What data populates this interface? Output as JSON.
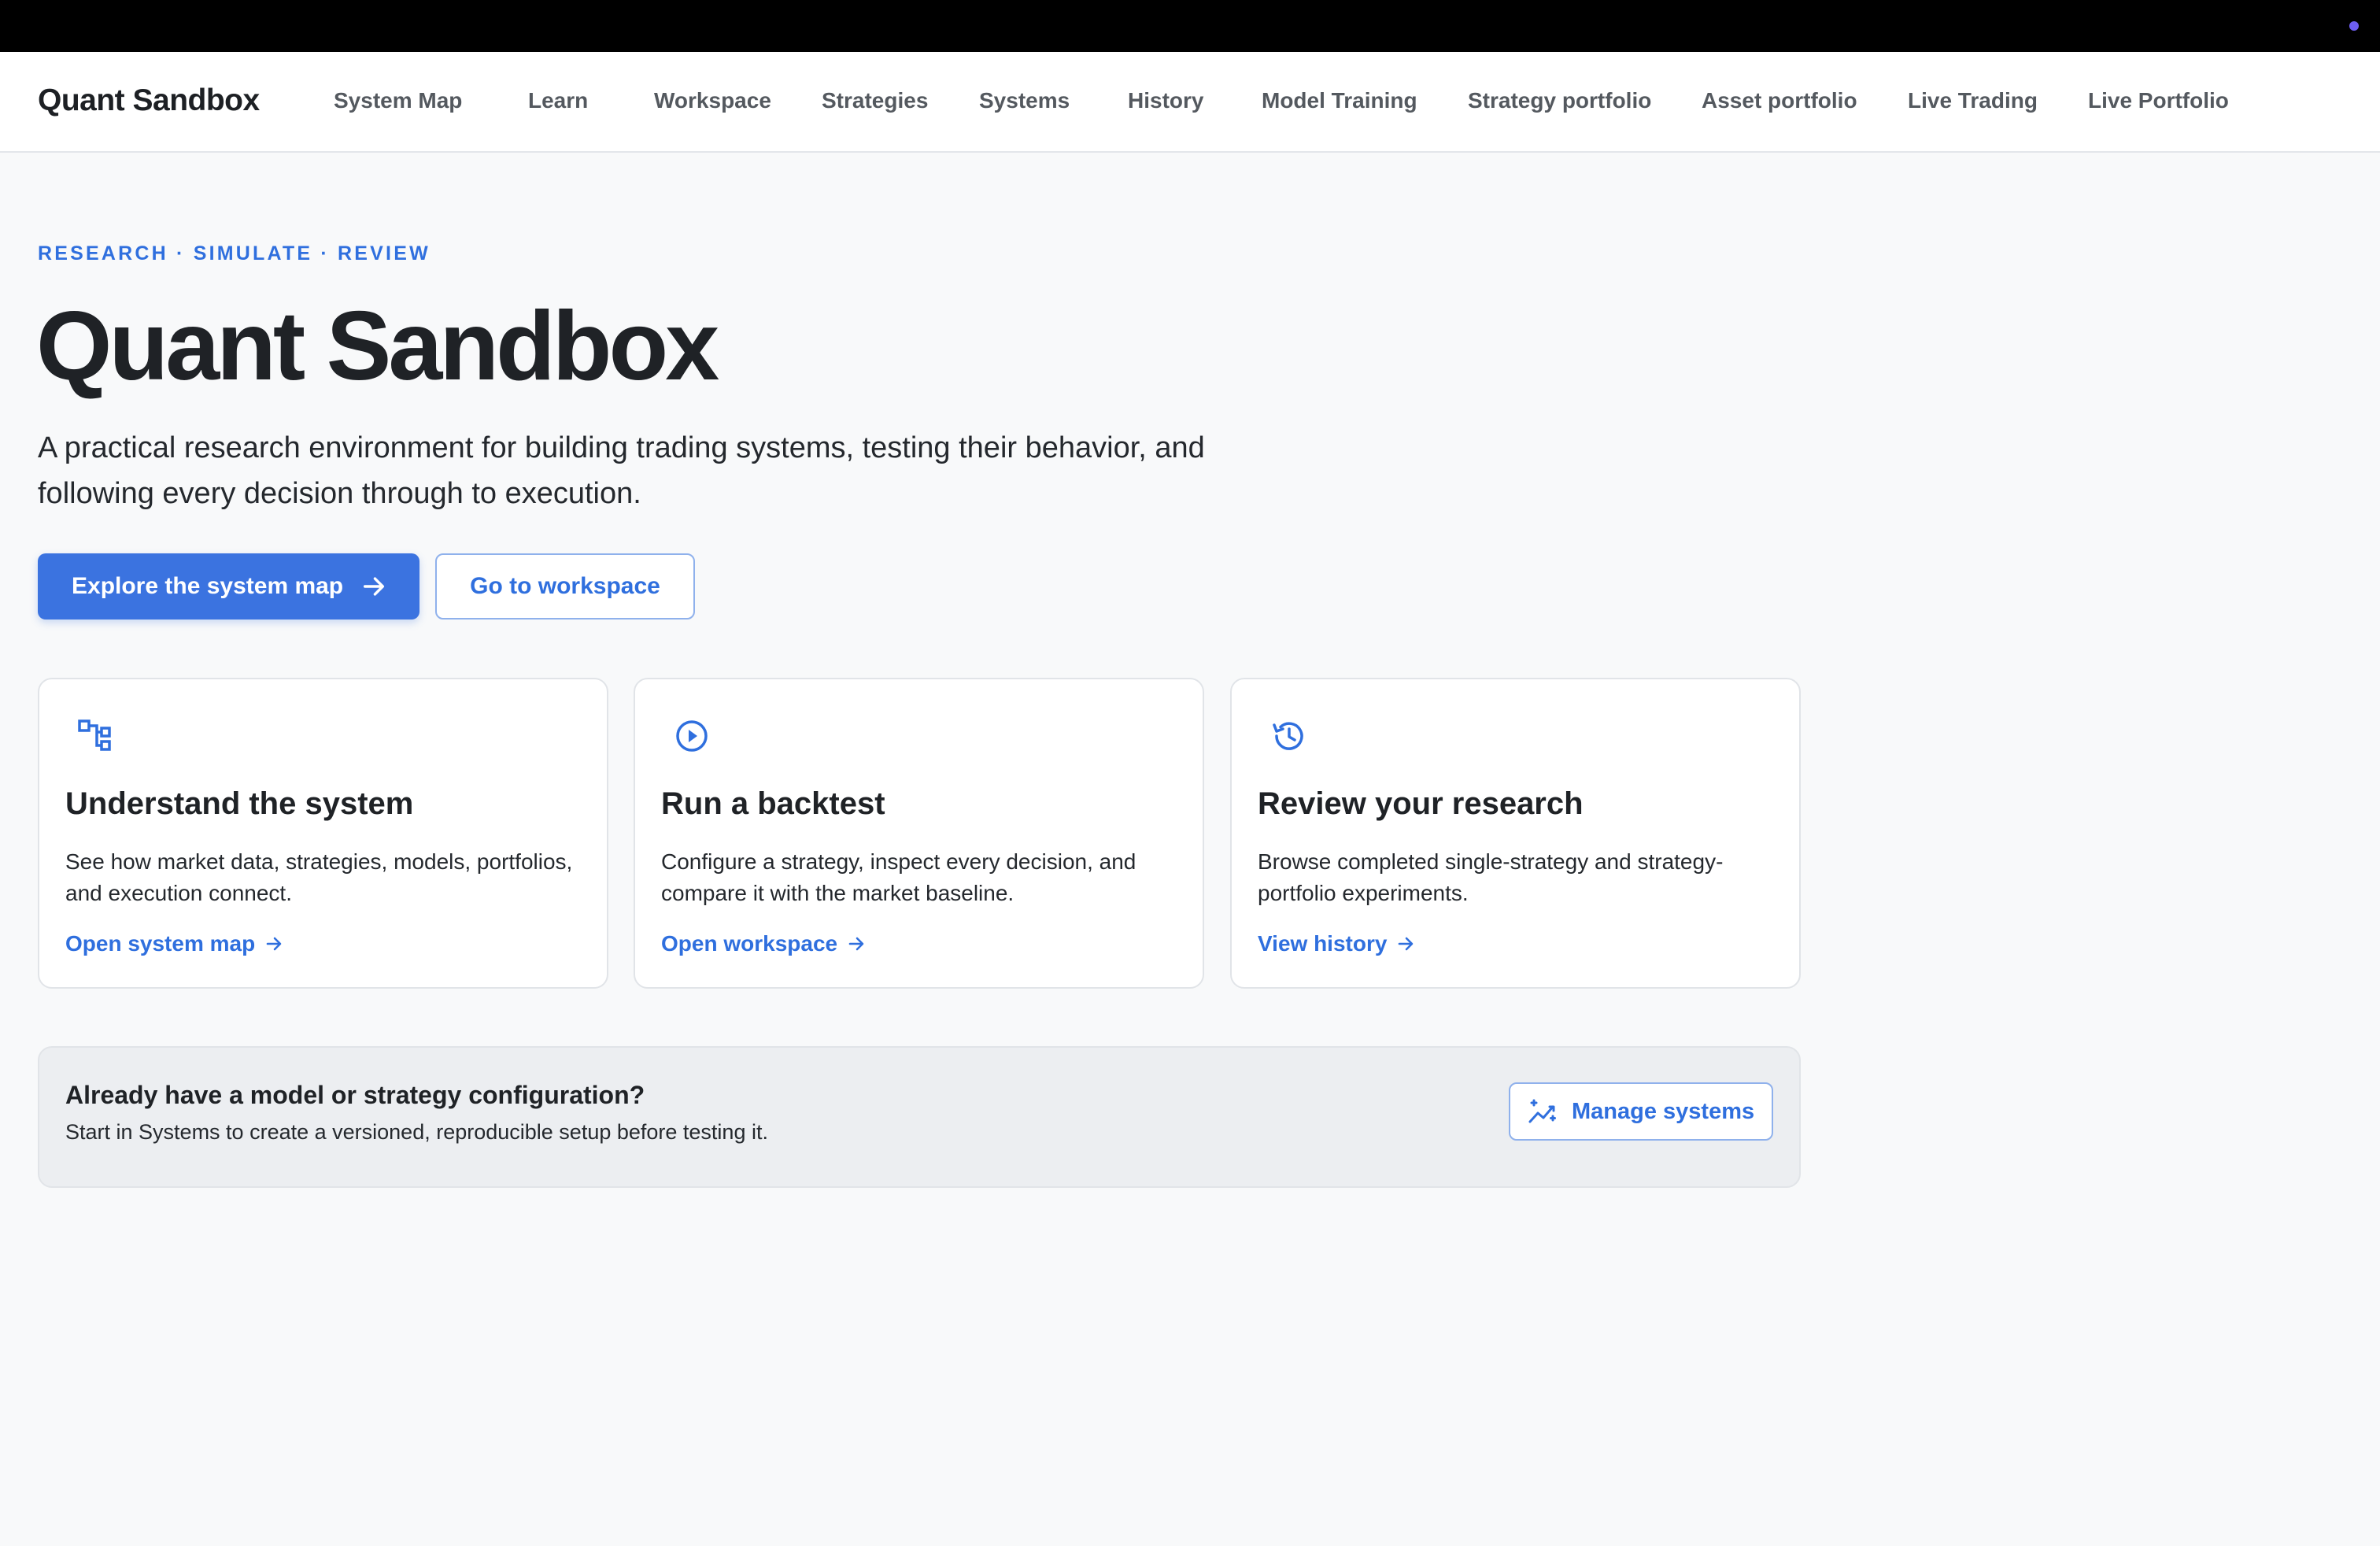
{
  "nav": {
    "brand": "Quant Sandbox",
    "items": [
      {
        "label": "System Map"
      },
      {
        "label": "Learn"
      },
      {
        "label": "Workspace"
      },
      {
        "label": "Strategies"
      },
      {
        "label": "Systems"
      },
      {
        "label": "History"
      },
      {
        "label": "Model Training"
      },
      {
        "label": "Strategy portfolio"
      },
      {
        "label": "Asset portfolio"
      },
      {
        "label": "Live Trading"
      },
      {
        "label": "Live Portfolio"
      }
    ]
  },
  "hero": {
    "eyebrow": "RESEARCH · SIMULATE · REVIEW",
    "title": "Quant Sandbox",
    "subtitle": "A practical research environment for building trading systems, testing their behavior, and following every decision through to execution.",
    "primary_button": "Explore the system map",
    "secondary_button": "Go to workspace"
  },
  "cards": [
    {
      "icon": "system-map-icon",
      "title": "Understand the system",
      "description": "See how market data, strategies, models, portfolios, and execution connect.",
      "link": "Open system map"
    },
    {
      "icon": "play-circle-icon",
      "title": "Run a backtest",
      "description": "Configure a strategy, inspect every decision, and compare it with the market baseline.",
      "link": "Open workspace"
    },
    {
      "icon": "history-icon",
      "title": "Review your research",
      "description": "Browse completed single-strategy and strategy-portfolio experiments.",
      "link": "View history"
    }
  ],
  "banner": {
    "title": "Already have a model or strategy configuration?",
    "text": "Start in Systems to create a versioned, reproducible setup before testing it.",
    "button": "Manage systems",
    "button_icon": "sparkle-chart-icon"
  },
  "colors": {
    "accent": "#3b73e0",
    "link": "#2f6fde",
    "topbar": "#000000",
    "status_dot": "#6e5ef2"
  }
}
